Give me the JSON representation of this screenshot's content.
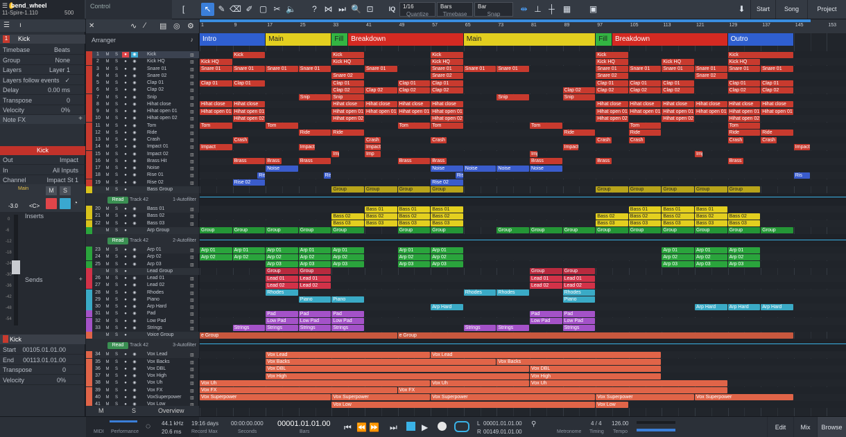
{
  "song": {
    "title": "bend_wheel",
    "subtitle": "11-Spire-1.110",
    "value": "500",
    "control_label": "Control"
  },
  "toolbar": {
    "quantize_value": "1/16",
    "quantize_label": "Quantize",
    "timebase_value": "Bars",
    "timebase_label": "Timebase",
    "snap_value": "Bar",
    "snap_label": "Snap",
    "iq_label": "IQ",
    "start_label": "Start",
    "song_label": "Song",
    "project_label": "Project"
  },
  "inspector": {
    "track_num": "1",
    "track_name": "Kick",
    "rows": [
      {
        "k": "Timebase",
        "v": "Beats"
      },
      {
        "k": "Group",
        "v": "None"
      },
      {
        "k": "Layers",
        "v": "Layer 1"
      },
      {
        "k": "Layers follow events",
        "v": "✓"
      },
      {
        "k": "Delay",
        "v": "0.00 ms"
      },
      {
        "k": "Transpose",
        "v": "0"
      },
      {
        "k": "Velocity",
        "v": "0%"
      }
    ],
    "note_fx": "Note FX",
    "channel_name": "Kick",
    "io_rows": [
      {
        "k": "Out",
        "v": "Impact"
      },
      {
        "k": "In",
        "v": "All Inputs"
      },
      {
        "k": "Channel",
        "v": "Impact St 1"
      }
    ],
    "main_label": "Main",
    "m_label": "M",
    "s_label": "S",
    "volume": "-3.0",
    "pan": "<C>",
    "inserts_label": "Inserts",
    "sends_label": "Sends",
    "event_name": "Kick",
    "event_rows": [
      {
        "k": "Start",
        "v": "00105.01.01.00"
      },
      {
        "k": "End",
        "v": "00113.01.01.00"
      },
      {
        "k": "Transpose",
        "v": "0"
      },
      {
        "k": "Velocity",
        "v": "0%"
      }
    ],
    "scale_marks": [
      "0",
      "-6",
      "-12",
      "-18",
      "-24",
      "-30",
      "-36",
      "-42",
      "-48",
      "-54"
    ]
  },
  "tracklist": {
    "header": "Arranger",
    "tracks": [
      {
        "n": "1",
        "name": "Kick",
        "c": "#c83a2e"
      },
      {
        "n": "2",
        "name": "Kick HQ",
        "c": "#c83a2e"
      },
      {
        "n": "3",
        "name": "Snare 01",
        "c": "#c83a2e"
      },
      {
        "n": "4",
        "name": "Snare 02",
        "c": "#c83a2e"
      },
      {
        "n": "5",
        "name": "Clap 01",
        "c": "#c83a2e"
      },
      {
        "n": "6",
        "name": "Clap 02",
        "c": "#c83a2e"
      },
      {
        "n": "7",
        "name": "Snip",
        "c": "#c83a2e"
      },
      {
        "n": "8",
        "name": "Hihat close",
        "c": "#c83a2e"
      },
      {
        "n": "9",
        "name": "Hihat open 01",
        "c": "#c83a2e"
      },
      {
        "n": "10",
        "name": "Hihat open 02",
        "c": "#c83a2e"
      },
      {
        "n": "11",
        "name": "Tom",
        "c": "#c83a2e"
      },
      {
        "n": "12",
        "name": "Ride",
        "c": "#c83a2e"
      },
      {
        "n": "13",
        "name": "Crash",
        "c": "#c83a2e"
      },
      {
        "n": "14",
        "name": "Impact 01",
        "c": "#c83a2e"
      },
      {
        "n": "15",
        "name": "Impact 02",
        "c": "#c83a2e"
      },
      {
        "n": "16",
        "name": "Brass Hit",
        "c": "#c83a2e"
      },
      {
        "n": "17",
        "name": "Noise",
        "c": "#c83a2e"
      },
      {
        "n": "18",
        "name": "Rise 01",
        "c": "#c83a2e"
      },
      {
        "n": "19",
        "name": "Rise 02",
        "c": "#c83a2e"
      }
    ],
    "group_bass": "Bass Group",
    "bass_tracks": [
      {
        "n": "20",
        "name": "Bass 01",
        "c": "#d8c21c"
      },
      {
        "n": "21",
        "name": "Bass 02",
        "c": "#d8c21c"
      },
      {
        "n": "22",
        "name": "Bass 03",
        "c": "#d8c21c"
      }
    ],
    "group_arp": "Arp Group",
    "arp_tracks": [
      {
        "n": "23",
        "name": "Arp 01",
        "c": "#2aa43c"
      },
      {
        "n": "24",
        "name": "Arp 02",
        "c": "#2aa43c"
      },
      {
        "n": "25",
        "name": "Arp 03",
        "c": "#2aa43c"
      }
    ],
    "group_lead": "Lead Group",
    "lead_tracks": [
      {
        "n": "26",
        "name": "Lead 01",
        "c": "#d23248"
      },
      {
        "n": "27",
        "name": "Lead 02",
        "c": "#d23248"
      },
      {
        "n": "28",
        "name": "Rhodes",
        "c": "#3aaac6"
      },
      {
        "n": "29",
        "name": "Piano",
        "c": "#3aaac6"
      },
      {
        "n": "30",
        "name": "Arp Hard",
        "c": "#3aaac6"
      },
      {
        "n": "31",
        "name": "Pad",
        "c": "#a452c8"
      },
      {
        "n": "32",
        "name": "Low Pad",
        "c": "#a452c8"
      },
      {
        "n": "33",
        "name": "Strings",
        "c": "#a452c8"
      }
    ],
    "group_voice": "Voice Group",
    "voice_tracks": [
      {
        "n": "34",
        "name": "Vox Lead",
        "c": "#e06448"
      },
      {
        "n": "35",
        "name": "Vox Backs",
        "c": "#e06448"
      },
      {
        "n": "36",
        "name": "Vox DBL",
        "c": "#e06448"
      },
      {
        "n": "37",
        "name": "Vox High",
        "c": "#e06448"
      },
      {
        "n": "38",
        "name": "Vox Uh",
        "c": "#e06448"
      },
      {
        "n": "39",
        "name": "Vox FX",
        "c": "#e06448"
      },
      {
        "n": "40",
        "name": "VoxSuperpower",
        "c": "#e06448"
      },
      {
        "n": "41",
        "name": "Vox Low",
        "c": "#e06448"
      }
    ],
    "read_label": "Read",
    "auto1": {
      "track": "Track 42",
      "name": "1-Autofilter"
    },
    "auto2": {
      "track": "Track 42",
      "name": "2-Autofilter"
    },
    "auto3": {
      "track": "Track 42",
      "name": "3-Autofilter"
    },
    "footer_m": "M",
    "footer_s": "S",
    "footer_overview": "Overview"
  },
  "ruler": {
    "numbers": [
      "1",
      "9",
      "17",
      "25",
      "33",
      "41",
      "49",
      "57",
      "65",
      "73",
      "81",
      "89",
      "97",
      "105",
      "113",
      "121",
      "129",
      "137",
      "145",
      "153"
    ]
  },
  "markers": [
    {
      "name": "Intro",
      "start": 1,
      "end": 17,
      "color": "#2f5fd0"
    },
    {
      "name": "Main",
      "start": 17,
      "end": 33,
      "color": "#e3cf1f"
    },
    {
      "name": "Fill",
      "start": 33,
      "end": 37,
      "color": "#33b542"
    },
    {
      "name": "Breakdown",
      "start": 37,
      "end": 65,
      "color": "#d42a22"
    },
    {
      "name": "Main",
      "start": 65,
      "end": 97,
      "color": "#e3cf1f"
    },
    {
      "name": "Fill",
      "start": 97,
      "end": 101,
      "color": "#33b542"
    },
    {
      "name": "Breakdown",
      "start": 101,
      "end": 129,
      "color": "#d42a22"
    },
    {
      "name": "Outro",
      "start": 129,
      "end": 145,
      "color": "#2f5fd0"
    }
  ],
  "clip_labels": {
    "kick": "Kick",
    "kickhq": "Kick HQ",
    "snare1": "Snare 01",
    "snare2": "Snare 02",
    "clap1": "Clap 01",
    "clap2": "Clap 02",
    "snip": "Snip",
    "hhclose": "Hihat close",
    "hhopen1": "Hihat open 01",
    "hhopen2": "Hihat open 02",
    "tom": "Tom",
    "ride": "Ride",
    "crash": "Crash",
    "impact": "Impact",
    "imp": "Imp",
    "brass": "Brass",
    "noise": "Noise",
    "rise": "Ris",
    "rise2": "Rise 02",
    "group": "Group",
    "bass1": "Bass 01",
    "bass2": "Bass 02",
    "bass3": "Bass 03",
    "arp1": "Arp 01",
    "arp2": "Arp 02",
    "arp3": "Arp 03",
    "lead1": "Lead 01",
    "lead2": "Lead 02",
    "rhodes": "Rhodes",
    "piano": "Piano",
    "arphard": "Arp Hard",
    "pad": "Pad",
    "lowpad": "Low Pad",
    "strings": "Strings",
    "voxlead": "Vox Lead",
    "voxbacks": "Vox Backs",
    "voxdbl": "Vox DBL",
    "voxhigh": "Vox High",
    "voxuh": "Vox Uh",
    "voxfx": "Vox FX",
    "voxsuper": "Vox Superpower",
    "voxsuper2": "Vox Superpo",
    "voxlow": "Vox Low",
    "egroup": "e Group"
  },
  "transport": {
    "midi": "MIDI",
    "performance": "Performance",
    "khz": "44.1 kHz",
    "ms": "20.6 ms",
    "days": "19:16 days",
    "record_max": "Record Max",
    "seconds_value": "00:00:00.000",
    "seconds_label": "Seconds",
    "bars_value": "00001.01.01.00",
    "bars_label": "Bars",
    "l_label": "L",
    "l_value": "00001.01.01.00",
    "r_label": "R",
    "r_value": "00149.01.01.00",
    "metronome": "Metronome",
    "timing_value": "4 / 4",
    "timing_label": "Timing",
    "tempo_value": "126.00",
    "tempo_label": "Tempo",
    "edit": "Edit",
    "mix": "Mix",
    "browse": "Browse"
  },
  "colors": {
    "red": "#c83a2e",
    "yellow": "#e3cf1f",
    "green": "#2aa43c",
    "blue": "#3a5ccc",
    "cyan": "#3aaac6",
    "purple": "#a452c8",
    "orange": "#e06448",
    "pink": "#d23248",
    "accent": "#3b7fd9"
  }
}
